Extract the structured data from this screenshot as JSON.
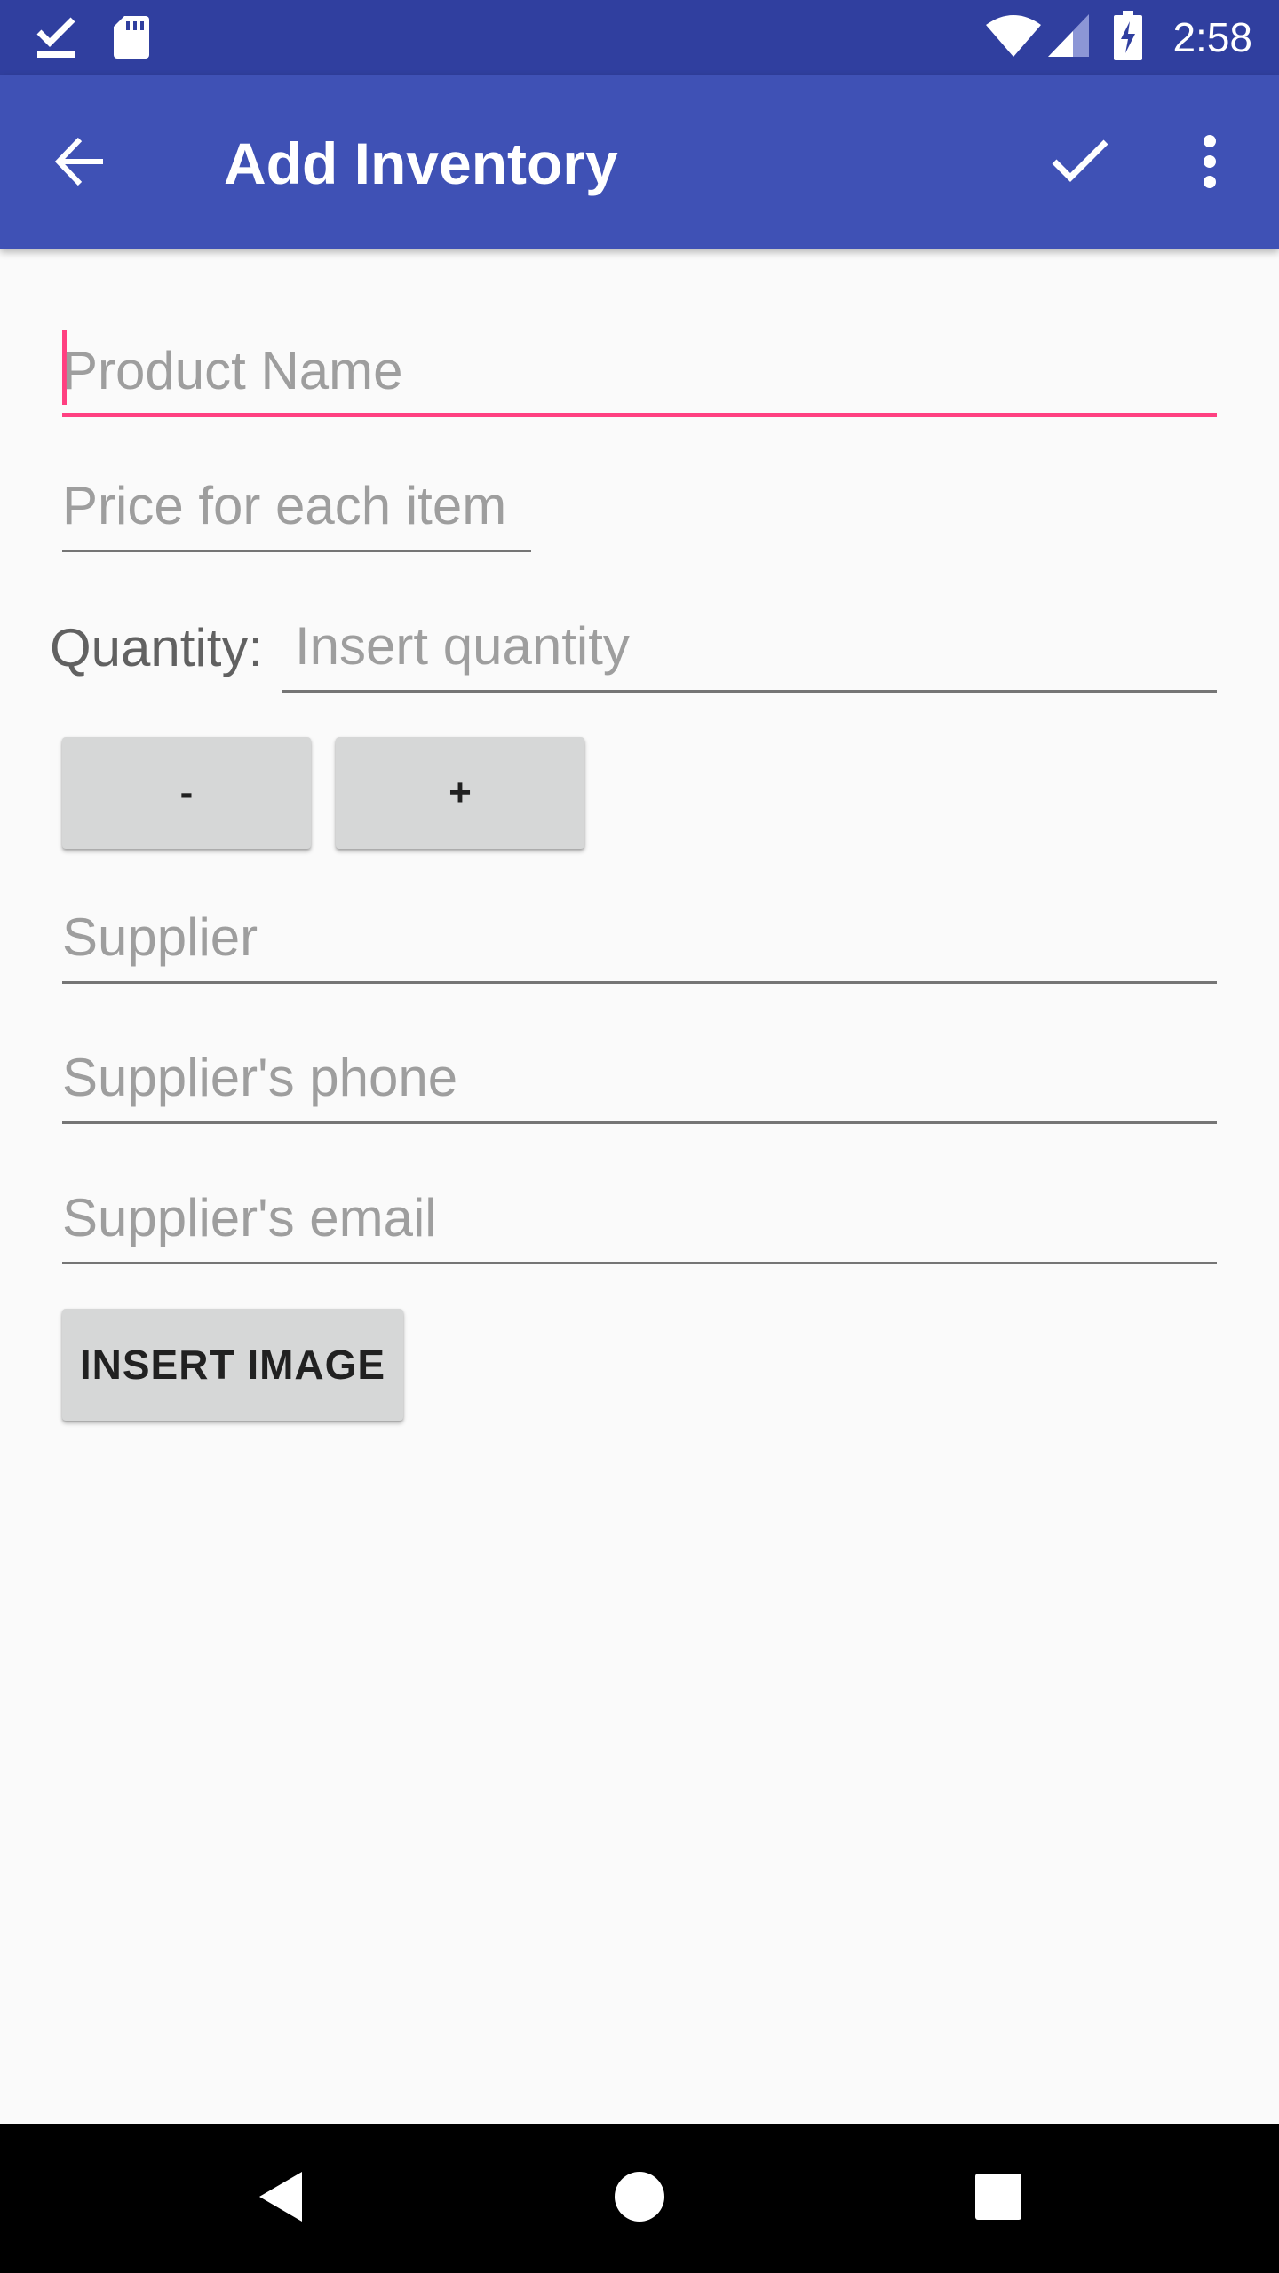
{
  "status_bar": {
    "time": "2:58",
    "left_icons": [
      "download-done-icon",
      "sd-card-icon"
    ],
    "right_icons": [
      "wifi-icon",
      "cell-signal-icon",
      "battery-charging-icon"
    ]
  },
  "app_bar": {
    "title": "Add Inventory",
    "navigation_icon": "arrow-back-icon",
    "action_icons": [
      "check-icon",
      "more-vert-icon"
    ]
  },
  "form": {
    "product_name": {
      "placeholder": "Product Name",
      "value": ""
    },
    "price": {
      "placeholder": "Price for each item",
      "value": ""
    },
    "quantity": {
      "label": "Quantity:",
      "placeholder": "Insert quantity",
      "value": ""
    },
    "decrement_label": "-",
    "increment_label": "+",
    "supplier": {
      "placeholder": "Supplier",
      "value": ""
    },
    "supplier_phone": {
      "placeholder": "Supplier's phone",
      "value": ""
    },
    "supplier_email": {
      "placeholder": "Supplier's email",
      "value": ""
    },
    "insert_image_label": "INSERT IMAGE"
  },
  "nav_bar": {
    "icons": [
      "back-triangle-icon",
      "home-circle-icon",
      "recents-square-icon"
    ]
  },
  "colors": {
    "status_bar": "#303f9f",
    "primary": "#3f51b5",
    "accent": "#ff4081",
    "background": "#fafafa",
    "button": "#d6d7d7",
    "nav_bar": "#000000"
  }
}
